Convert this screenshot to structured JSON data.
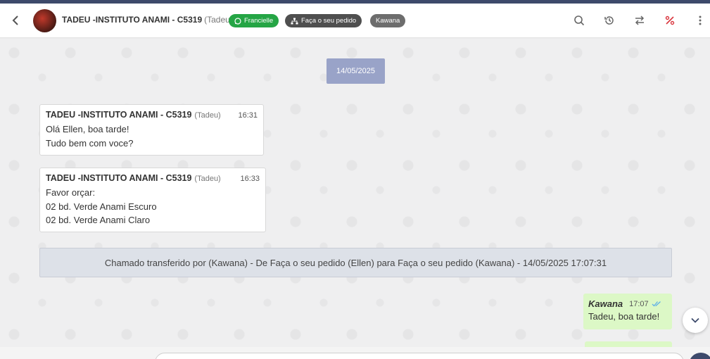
{
  "header": {
    "contact_name": "TADEU -INSTITUTO ANAMI - C5319",
    "contact_sub": "(Tadeu)",
    "tags": [
      {
        "label": "Francielle",
        "color": "#25a545",
        "icon": "whatsapp-icon"
      },
      {
        "label": "Faça o seu pedido",
        "color": "#4f4f4f",
        "icon": "sitemap-icon"
      },
      {
        "label": "Kawana",
        "color": "#6d6d6d"
      }
    ],
    "actions": [
      "search-icon",
      "history-icon",
      "transfer-icon",
      "percent-icon",
      "more-vertical-icon"
    ]
  },
  "chat": {
    "date_divider": "14/05/2025",
    "messages": [
      {
        "sender": "TADEU -INSTITUTO ANAMI - C5319",
        "sender_sub": "(Tadeu)",
        "time": "16:31",
        "lines": [
          "Olá Ellen, boa tarde!",
          "Tudo bem com voce?"
        ]
      },
      {
        "sender": "TADEU -INSTITUTO ANAMI - C5319",
        "sender_sub": "(Tadeu)",
        "time": "16:33",
        "lines": [
          "Favor orçar:",
          "02 bd. Verde Anami Escuro",
          "02 bd. Verde Anami Claro"
        ]
      }
    ],
    "system_message": "Chamado transferido por (Kawana) - De Faça o seu pedido (Ellen) para Faça o seu pedido (Kawana) - 14/05/2025 17:07:31",
    "outgoing": {
      "sender": "Kawana",
      "time": "17:07",
      "text": "Tadeu, boa tarde!"
    }
  },
  "colors": {
    "accent": "#3d4a6b",
    "outgoing_bubble": "#dcf8c6",
    "date_pill": "#99a3c8"
  }
}
